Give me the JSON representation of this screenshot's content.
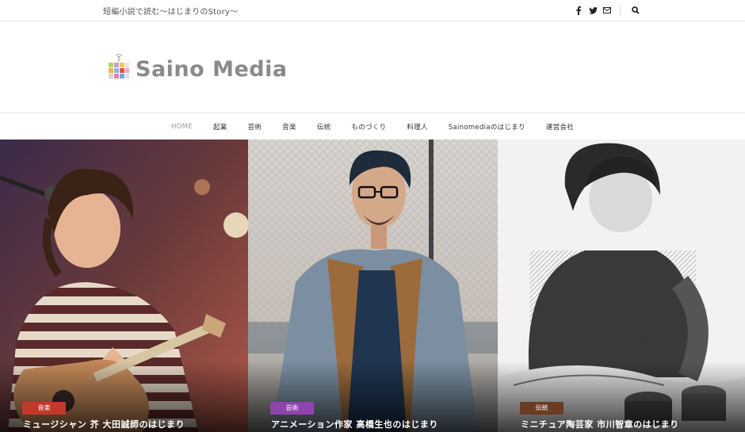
{
  "topbar": {
    "tagline": "短編小説で読む〜はじまりのStory〜",
    "icons": [
      "facebook-icon",
      "twitter-icon",
      "mail-icon",
      "search-icon"
    ]
  },
  "brand": {
    "logo_text": "Saino Media"
  },
  "nav": {
    "items": [
      {
        "label": "HOME",
        "active": true
      },
      {
        "label": "起業"
      },
      {
        "label": "芸術"
      },
      {
        "label": "音楽"
      },
      {
        "label": "伝統"
      },
      {
        "label": "ものづくり"
      },
      {
        "label": "料理人"
      },
      {
        "label": "Sainomediaのはじまり"
      },
      {
        "label": "運営会社"
      }
    ]
  },
  "cards": [
    {
      "category": "音楽",
      "title": "ミュージシャン 芥 大田誠師のはじまり",
      "color": "#c0392b"
    },
    {
      "category": "芸術",
      "title": "アニメーション作家 高橋生也のはじまり",
      "color": "#8e44ad"
    },
    {
      "category": "伝統",
      "title": "ミニチュア陶芸家 市川智章のはじまり",
      "color": "#6b3b23"
    }
  ]
}
